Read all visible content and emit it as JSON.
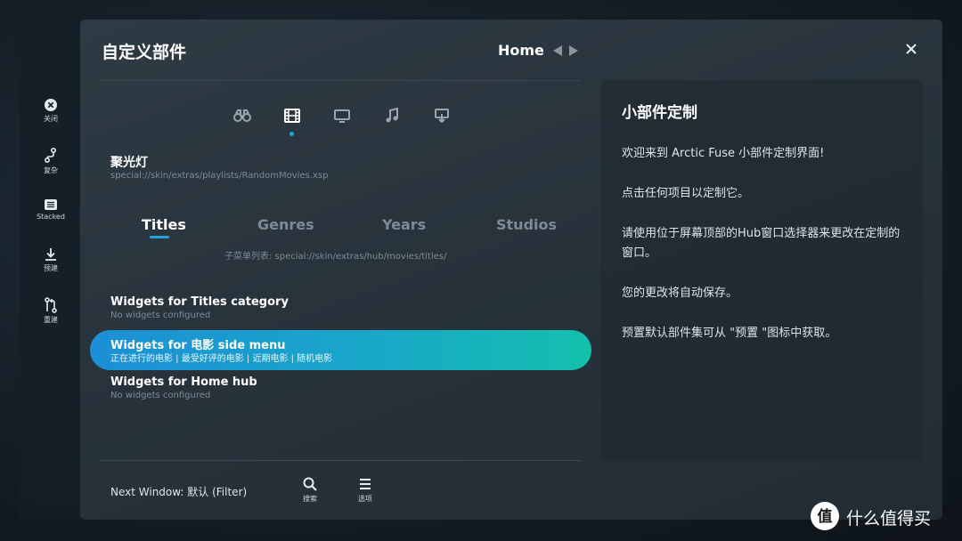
{
  "rail": [
    {
      "icon": "close-circle-icon",
      "label": "关闭"
    },
    {
      "icon": "branch-icon",
      "label": "复杂"
    },
    {
      "icon": "list-icon",
      "label": "Stacked"
    },
    {
      "icon": "download-icon",
      "label": "预建"
    },
    {
      "icon": "rebuild-icon",
      "label": "重建"
    }
  ],
  "header": {
    "title": "自定义部件",
    "hub": "Home"
  },
  "categories": [
    {
      "icon": "binoculars-icon"
    },
    {
      "icon": "film-icon",
      "active": true
    },
    {
      "icon": "tv-icon"
    },
    {
      "icon": "music-icon"
    },
    {
      "icon": "addon-icon"
    }
  ],
  "spotlight": {
    "title": "聚光灯",
    "path": "special://skin/extras/playlists/RandomMovies.xsp"
  },
  "tabs": [
    {
      "label": "Titles",
      "active": true
    },
    {
      "label": "Genres"
    },
    {
      "label": "Years"
    },
    {
      "label": "Studios"
    }
  ],
  "submenu": "子菜单列表: special://skin/extras/hub/movies/titles/",
  "widgets": [
    {
      "title": "Widgets for Titles category",
      "sub": "No widgets configured"
    },
    {
      "title": "Widgets for 电影 side menu",
      "sub": "正在进行的电影 | 最受好评的电影 | 近期电影 | 随机电影",
      "selected": true
    },
    {
      "title": "Widgets for Home hub",
      "sub": "No widgets configured"
    }
  ],
  "footer": {
    "next_window": "Next Window: 默认 (Filter)",
    "search_label": "搜索",
    "options_label": "选项"
  },
  "info": {
    "title": "小部件定制",
    "paragraphs": [
      "欢迎来到 Arctic Fuse 小部件定制界面!",
      "点击任何项目以定制它。",
      "请使用位于屏幕顶部的Hub窗口选择器来更改在定制的窗口。",
      "您的更改将自动保存。",
      "预置默认部件集可从 \"预置 \"图标中获取。"
    ]
  },
  "watermark": {
    "logo_char": "值",
    "text": "什么值得买"
  },
  "colors": {
    "accent": "#1ea6d8",
    "highlight_start": "#1c8fd6",
    "highlight_end": "#13c0ad"
  }
}
